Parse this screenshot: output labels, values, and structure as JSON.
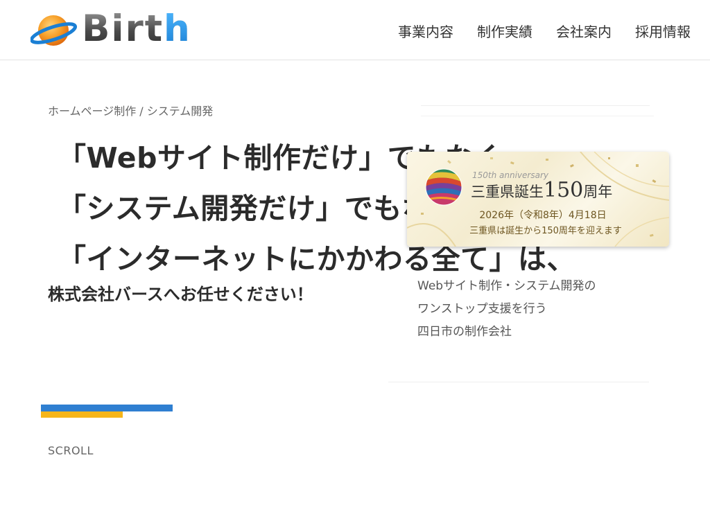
{
  "header": {
    "logo_text": "Birth",
    "logo_text_main": "Birt",
    "logo_text_accent": "h",
    "nav": [
      {
        "label": "事業内容"
      },
      {
        "label": "制作実績"
      },
      {
        "label": "会社案内"
      },
      {
        "label": "採用情報"
      }
    ]
  },
  "main": {
    "breadcrumb": "ホームページ制作 / システム開発",
    "hero_lines": [
      "「Webサイト制作だけ」でもなく、",
      "「システム開発だけ」でもなく、",
      "「インターネットにかかわる全て」は、"
    ],
    "sub_heading": "株式会社バースへお任せください！",
    "tagline_lines": [
      "Webサイト制作・システム開発の",
      "ワンストップ支援を行う",
      "四日市の制作会社"
    ],
    "scroll_label": "SCROLL"
  },
  "banner": {
    "anniversary": "150th anniversary",
    "title_prefix": "三重県誕生",
    "title_number": "150",
    "title_suffix": "周年",
    "date": "2026年（令和8年）4月18日",
    "note": "三重県は誕生から150周年を迎えます"
  },
  "colors": {
    "accent_blue": "#2f7fd1",
    "accent_yellow": "#f5b51a",
    "logo_orange": "#f08a1c",
    "logo_blue": "#1a7fd4"
  },
  "icons": {
    "logo": "planet-ring-icon",
    "banner_emblem": "mie-150th-emblem-icon"
  }
}
